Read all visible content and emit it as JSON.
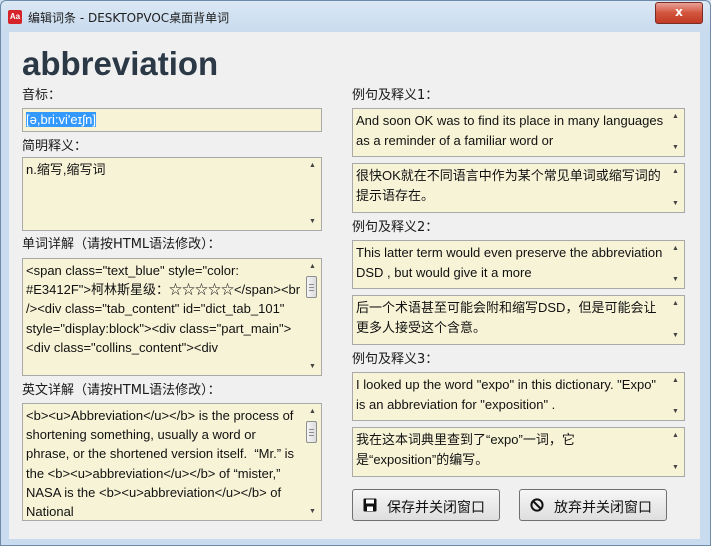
{
  "window": {
    "title": "编辑词条 - DESKTOPVOC桌面背单词",
    "app_icon_text": "Aa",
    "close_glyph": "x"
  },
  "word": "abbreviation",
  "phonetic": {
    "label": "音标：",
    "value": "[ə,bri:vi'eɪʃn]"
  },
  "brief": {
    "label": "简明释义：",
    "value": "n.缩写,缩写词"
  },
  "detail": {
    "label": "单词详解（请按HTML语法修改）：",
    "value": "<span class=\"text_blue\" style=\"color: #E3412F\">柯林斯星级：☆☆☆☆☆</span><br /><div class=\"tab_content\" id=\"dict_tab_101\" style=\"display:block\"><div class=\"part_main\"><div class=\"collins_content\"><div"
  },
  "english_detail": {
    "label": "英文详解（请按HTML语法修改）：",
    "value": "<b><u>Abbreviation</u></b> is the process of shortening something, usually a word or phrase, or the shortened version itself.  “Mr.” is the <b><u>abbreviation</u></b> of “mister,” NASA is the <b><u>abbreviation</u></b> of National"
  },
  "examples": [
    {
      "label": "例句及释义1：",
      "sentence": "And soon OK was to find its place in many languages as a reminder of a familiar word or",
      "translation": "很快OK就在不同语言中作为某个常见单词或缩写词的提示语存在。"
    },
    {
      "label": "例句及释义2：",
      "sentence": "This latter term would even preserve the abbreviation DSD , but would give it a more",
      "translation": "后一个术语甚至可能会附和缩写DSD，但是可能会让更多人接受这个含意。"
    },
    {
      "label": "例句及释义3：",
      "sentence": "I looked up the word \"expo\" in this dictionary. \"Expo\" is an abbreviation for \"exposition\" .",
      "translation": "我在这本词典里查到了“expo”一词，它是“exposition”的编写。"
    }
  ],
  "buttons": {
    "save": "保存并关闭窗口",
    "discard": "放弃并关闭窗口"
  },
  "icons": {
    "save": "floppy-disk-icon",
    "discard": "no-entry-icon"
  },
  "colors": {
    "field_bg": "#f7f3d6",
    "title_bar": "#c9dbee",
    "close_button": "#c23a24",
    "word_text": "#2b3846",
    "selection": "#3399ff"
  }
}
